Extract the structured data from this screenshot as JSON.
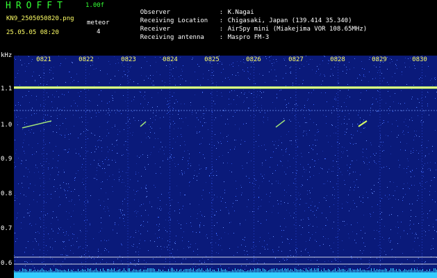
{
  "header": {
    "brand": "HROFFT",
    "version": "1.00f",
    "filename": "KN9_2505050820.png",
    "datetime": "25.05.05 08:20",
    "meteor_label": "meteor",
    "meteor_count": "4",
    "info": [
      {
        "key": "Observer",
        "value": "K.Nagai"
      },
      {
        "key": "Receiving Location",
        "value": "Chigasaki, Japan (139.414 35.340)"
      },
      {
        "key": "Receiver",
        "value": "AirSpy mini (Miakejima VOR 108.65MHz)"
      },
      {
        "key": "Receiving antenna",
        "value": "Maspro FM-3"
      }
    ]
  },
  "spectrogram": {
    "unit": "kHz",
    "y_ticks": [
      "1.1",
      "1.0",
      "0.9",
      "0.8",
      "0.7",
      "0.6"
    ],
    "x_ticks": [
      "0821",
      "0822",
      "0823",
      "0824",
      "0825",
      "0826",
      "0827",
      "0828",
      "0829",
      "0830"
    ],
    "colors": {
      "background": "#0a1a7a",
      "carrier": "#d8ff66",
      "baseline": "#33ccff",
      "tick_label": "#ffff66"
    }
  }
}
